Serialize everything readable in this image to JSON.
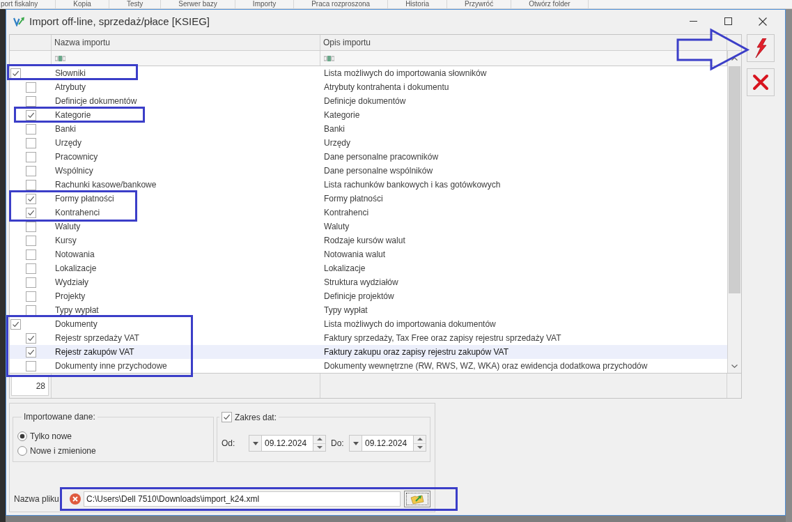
{
  "background_toolbar": {
    "items": [
      "port fiskalny",
      "Kopia",
      "Testy",
      "Serwer bazy",
      "Importy",
      "Praca rozproszona",
      "Historia",
      "Przywróć",
      "Otwórz folder"
    ]
  },
  "window": {
    "title": "Import off-line, sprzedaż/płace [KSIEG]"
  },
  "table": {
    "columns": [
      "Nazwa importu",
      "Opis importu"
    ],
    "rows": [
      {
        "name": "Słowniki",
        "description": "Lista możliwych do importowania słowników",
        "checked": true,
        "selected": false,
        "children": [
          {
            "name": "Atrybuty",
            "description": "Atrybuty kontrahenta i dokumentu",
            "checked": false,
            "selected": false
          },
          {
            "name": "Definicje dokumentów",
            "description": "Definicje dokumentów",
            "checked": false,
            "selected": false
          },
          {
            "name": "Kategorie",
            "description": "Kategorie",
            "checked": true,
            "selected": false
          },
          {
            "name": "Banki",
            "description": "Banki",
            "checked": false,
            "selected": false
          },
          {
            "name": "Urzędy",
            "description": "Urzędy",
            "checked": false,
            "selected": false
          },
          {
            "name": "Pracownicy",
            "description": "Dane personalne pracowników",
            "checked": false,
            "selected": false
          },
          {
            "name": "Wspólnicy",
            "description": "Dane personalne wspólników",
            "checked": false,
            "selected": false
          },
          {
            "name": "Rachunki kasowe/bankowe",
            "description": "Lista rachunków bankowych i kas gotówkowych",
            "checked": false,
            "selected": false
          },
          {
            "name": "Formy płatności",
            "description": "Formy płatności",
            "checked": true,
            "selected": false
          },
          {
            "name": "Kontrahenci",
            "description": "Kontrahenci",
            "checked": true,
            "selected": false
          },
          {
            "name": "Waluty",
            "description": "Waluty",
            "checked": false,
            "selected": false
          },
          {
            "name": "Kursy",
            "description": "Rodzaje kursów walut",
            "checked": false,
            "selected": false
          },
          {
            "name": "Notowania",
            "description": "Notowania walut",
            "checked": false,
            "selected": false
          },
          {
            "name": "Lokalizacje",
            "description": "Lokalizacje",
            "checked": false,
            "selected": false
          },
          {
            "name": "Wydziały",
            "description": "Struktura wydziałów",
            "checked": false,
            "selected": false
          },
          {
            "name": "Projekty",
            "description": "Definicje projektów",
            "checked": false,
            "selected": false
          },
          {
            "name": "Typy wypłat",
            "description": "Typy wypłat",
            "checked": false,
            "selected": false
          }
        ]
      },
      {
        "name": "Dokumenty",
        "description": "Lista możliwych do importowania dokumentów",
        "checked": true,
        "selected": false,
        "children": [
          {
            "name": "Rejestr sprzedaży VAT",
            "description": "Faktury sprzedaży, Tax Free oraz zapisy rejestru sprzedaży VAT",
            "checked": true,
            "selected": false
          },
          {
            "name": "Rejestr zakupów VAT",
            "description": "Faktury zakupu oraz zapisy rejestru zakupów VAT",
            "checked": true,
            "selected": true
          },
          {
            "name": "Dokumenty inne przychodowe",
            "description": "Dokumenty wewnętrzne (RW, RWS, WZ, WKA) oraz ewidencja dodatkowa przychodów",
            "checked": false,
            "selected": false
          }
        ]
      }
    ],
    "count": "28"
  },
  "imported_data": {
    "legend": "Importowane dane:",
    "options": [
      {
        "label": "Tylko nowe",
        "selected": true
      },
      {
        "label": "Nowe i zmienione",
        "selected": false
      }
    ]
  },
  "date_range": {
    "label": "Zakres dat:",
    "checked": true,
    "from": {
      "label": "Od:",
      "value": "09.12.2024"
    },
    "to": {
      "label": "Do:",
      "value": "09.12.2024"
    }
  },
  "file": {
    "label": "Nazwa pliku",
    "value": "C:\\Users\\Dell 7510\\Downloads\\import_k24.xml"
  }
}
